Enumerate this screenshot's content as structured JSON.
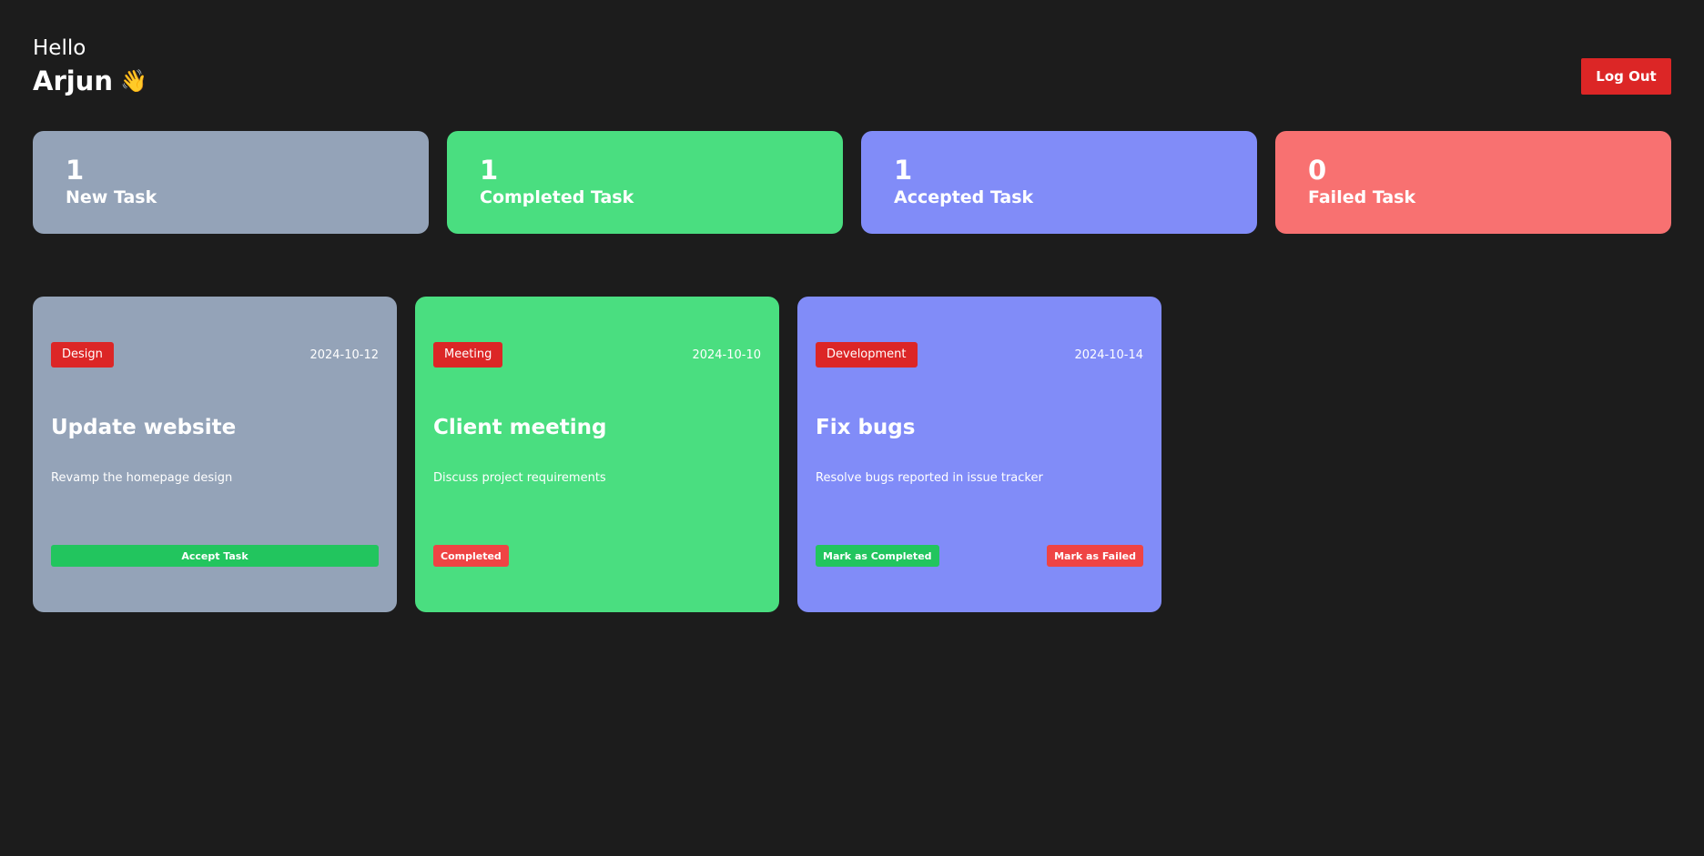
{
  "header": {
    "hello": "Hello",
    "name": "Arjun",
    "wave_emoji": "👋",
    "logout_label": "Log Out"
  },
  "stats": [
    {
      "count": "1",
      "label": "New Task",
      "color": "#94a3b8"
    },
    {
      "count": "1",
      "label": "Completed Task",
      "color": "#4ade80"
    },
    {
      "count": "1",
      "label": "Accepted Task",
      "color": "#818cf8"
    },
    {
      "count": "0",
      "label": "Failed Task",
      "color": "#f87171"
    }
  ],
  "tasks": [
    {
      "category": "Design",
      "date": "2024-10-12",
      "title": "Update website",
      "description": "Revamp the homepage design",
      "color": "#94a3b8",
      "actions": [
        {
          "label": "Accept Task",
          "style": "green-full"
        }
      ]
    },
    {
      "category": "Meeting",
      "date": "2024-10-10",
      "title": "Client meeting",
      "description": "Discuss project requirements",
      "color": "#4ade80",
      "actions": [
        {
          "label": "Completed",
          "style": "red"
        }
      ]
    },
    {
      "category": "Development",
      "date": "2024-10-14",
      "title": "Fix bugs",
      "description": "Resolve bugs reported in issue tracker",
      "color": "#818cf8",
      "actions": [
        {
          "label": "Mark as Completed",
          "style": "green"
        },
        {
          "label": "Mark as Failed",
          "style": "red"
        }
      ]
    }
  ]
}
